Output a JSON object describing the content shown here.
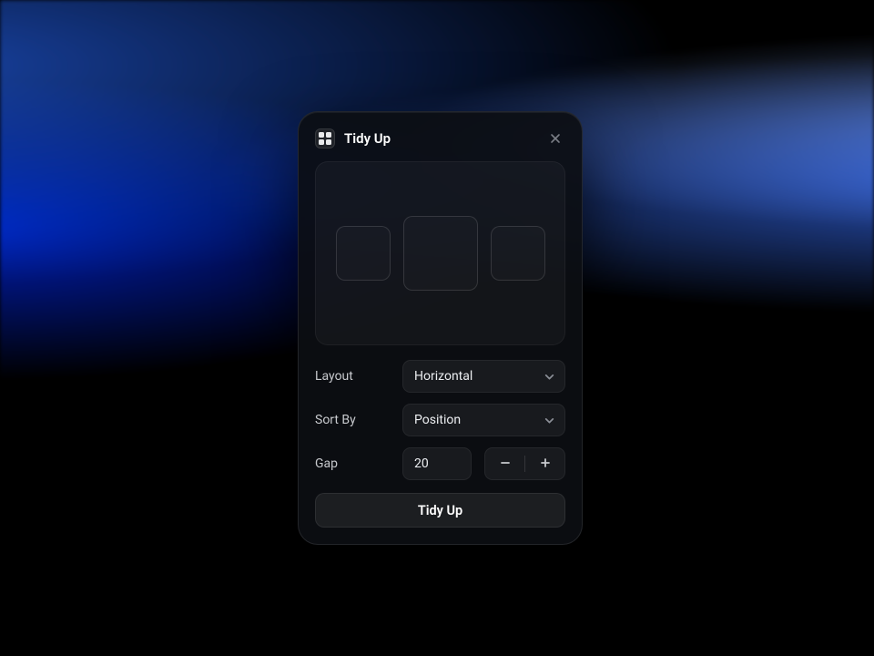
{
  "dialog": {
    "title": "Tidy Up",
    "layout": {
      "label": "Layout",
      "value": "Horizontal"
    },
    "sort": {
      "label": "Sort By",
      "value": "Position"
    },
    "gap": {
      "label": "Gap",
      "value": "20"
    },
    "primary_label": "Tidy Up"
  }
}
